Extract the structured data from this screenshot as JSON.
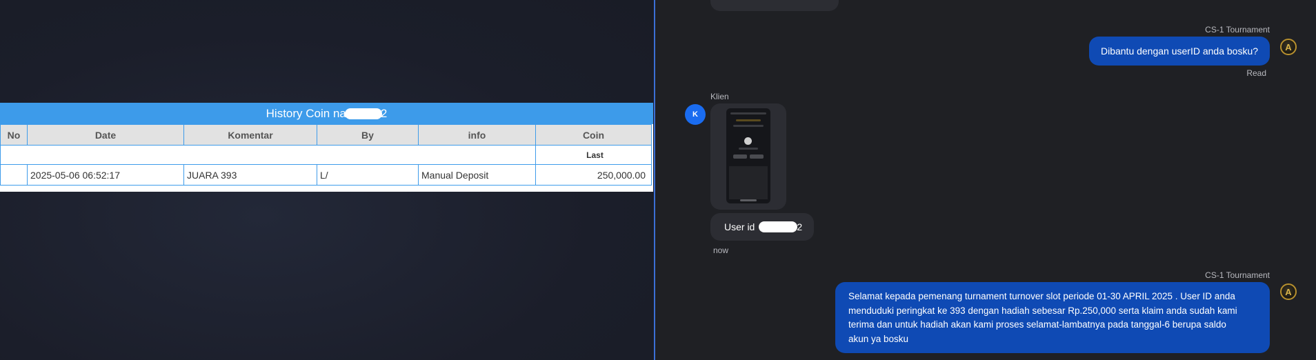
{
  "history": {
    "title_prefix": "History Coin na",
    "title_suffix": "2",
    "columns": [
      "No",
      "Date",
      "Komentar",
      "By",
      "info",
      "Coin"
    ],
    "last_label": "Last",
    "row": {
      "no": "",
      "date": "2025-05-06 06:52:17",
      "komentar": "JUARA 393",
      "by": "L/",
      "info": "Manual Deposit",
      "coin": "250,000.00"
    }
  },
  "chat": {
    "agent_name_1": "CS-1 Tournament",
    "agent_msg_1": "Dibantu dengan userID anda bosku?",
    "read_status": "Read",
    "client_name": "Klien",
    "client_avatar_initial": "K",
    "client_msg_prefix": "User id",
    "client_msg_suffix": "2",
    "client_time": "now",
    "agent_name_2": "CS-1 Tournament",
    "agent_msg_2_lines": [
      "Selamat kepada pemenang turnament turnover slot periode 01-30 APRIL 2025 . User ID anda",
      "menduduki peringkat ke 393 dengan hadiah sebesar Rp.250,000 serta klaim anda sudah kami",
      "terima dan untuk hadiah akan kami proses selamat-lambatnya pada tanggal-6 berupa saldo",
      "akun ya bosku"
    ],
    "agent_avatar_icon": "gold-emblem-icon"
  },
  "colors": {
    "table_header": "#3d9bea",
    "agent_bubble": "#0f4ab4",
    "coin_value": "#1e8a1e",
    "client_avatar": "#1a6cf0"
  }
}
